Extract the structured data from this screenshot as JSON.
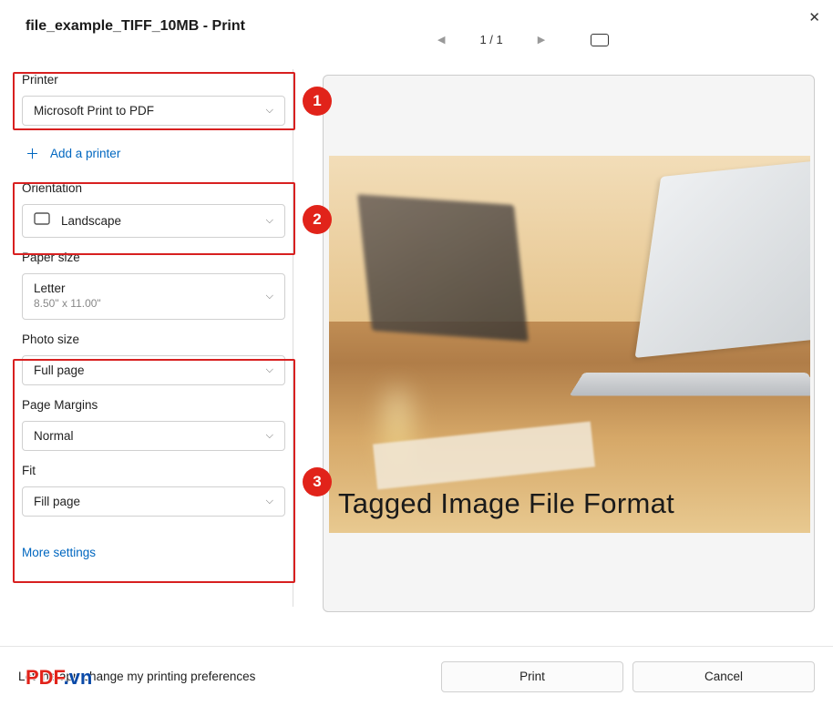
{
  "header": {
    "title": "file_example_TIFF_10MB - Print",
    "page_indicator": "1 / 1"
  },
  "sidebar": {
    "printer_label": "Printer",
    "printer_value": "Microsoft Print to PDF",
    "add_printer": "Add a printer",
    "orientation_label": "Orientation",
    "orientation_value": "Landscape",
    "paper_label": "Paper size",
    "paper_value": "Letter",
    "paper_sub": "8.50\" x 11.00\"",
    "photo_label": "Photo size",
    "photo_value": "Full page",
    "margins_label": "Page Margins",
    "margins_value": "Normal",
    "fit_label": "Fit",
    "fit_value": "Fill page",
    "more": "More settings"
  },
  "badges": {
    "b1": "1",
    "b2": "2",
    "b3": "3"
  },
  "preview": {
    "caption": "Tagged Image File Format"
  },
  "footer": {
    "pref": "Let the app change my printing preferences",
    "print": "Print",
    "cancel": "Cancel",
    "wm_pdf": "PDF",
    "wm_vn": ".vn"
  }
}
